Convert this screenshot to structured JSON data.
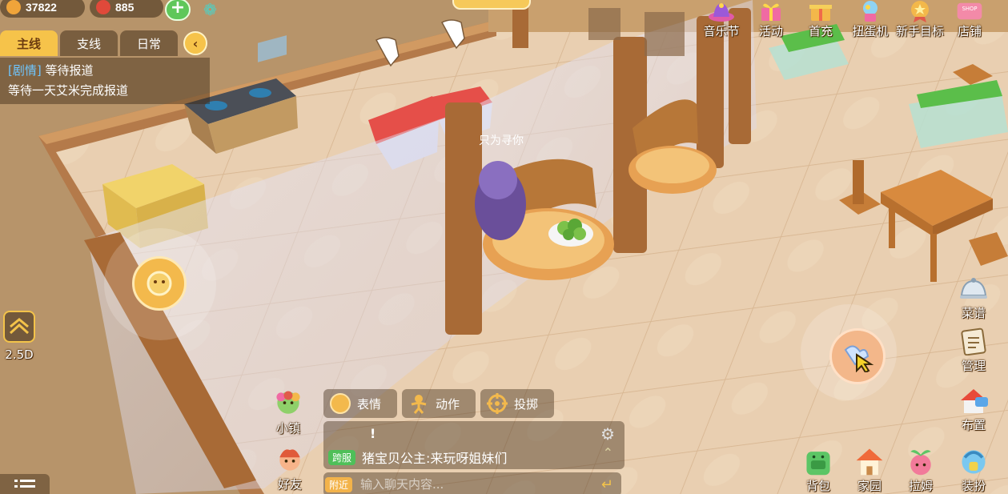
{
  "currency": {
    "gold": "37822",
    "gems": "885",
    "add_label": "+",
    "ribbon_icon": "ribbon-icon",
    "colors": {
      "gold": "#f0a43a",
      "gem": "#e0493a"
    }
  },
  "quest": {
    "tabs": [
      "主线",
      "支线",
      "日常"
    ],
    "active_tab": 0,
    "collapse_icon": "chevron-left-icon",
    "tag": "[剧情]",
    "title": "等待报道",
    "detail": "等待一天艾米完成报道"
  },
  "top_menu": [
    {
      "label": "音乐节",
      "icon": "hat-icon"
    },
    {
      "label": "活动",
      "icon": "gift-icon"
    },
    {
      "label": "首充",
      "icon": "gift-box-icon"
    },
    {
      "label": "扭蛋机",
      "icon": "gacha-icon"
    },
    {
      "label": "新手目标",
      "icon": "medal-icon"
    },
    {
      "label": "店铺",
      "icon": "shop-icon"
    }
  ],
  "shop_sign": "SHOP",
  "left_controls": {
    "view_mode_label": "2.5D",
    "view_mode_icon": "camera-icon"
  },
  "right_controls": [
    {
      "label": "菜谱",
      "icon": "cloche-icon"
    },
    {
      "label": "管理",
      "icon": "clipboard-icon"
    },
    {
      "label": "布置",
      "icon": "build-icon"
    }
  ],
  "bottom_left": [
    {
      "label": "小镇",
      "icon": "town-icon"
    },
    {
      "label": "好友",
      "icon": "friend-icon"
    }
  ],
  "bottom_right": [
    {
      "label": "背包",
      "icon": "backpack-icon"
    },
    {
      "label": "家园",
      "icon": "home-icon"
    },
    {
      "label": "拉姆",
      "icon": "lamu-icon"
    },
    {
      "label": "装扮",
      "icon": "dressup-icon"
    }
  ],
  "emotes": [
    {
      "label": "表情",
      "icon": "face-icon"
    },
    {
      "label": "动作",
      "icon": "pose-icon"
    },
    {
      "label": "投掷",
      "icon": "target-icon"
    }
  ],
  "chat": {
    "alert": "!",
    "channel": "跨服",
    "message": "猪宝贝公主:来玩呀姐妹们",
    "input_channel": "附近",
    "placeholder": "输入聊天内容...",
    "settings_icon": "gear-icon",
    "expand_icon": "chevron-up-icon",
    "send_icon": "enter-icon"
  },
  "world": {
    "player_name_partial": "只为寻你"
  }
}
